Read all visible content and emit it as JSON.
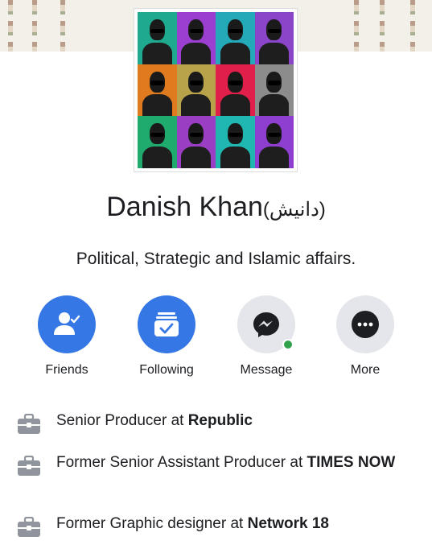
{
  "profile": {
    "name": "Danish Khan",
    "name_native": "(دانیش)",
    "bio": "Political, Strategic and Islamic affairs."
  },
  "actions": [
    {
      "label": "Friends",
      "icon": "friends-check-icon",
      "style": "blue"
    },
    {
      "label": "Following",
      "icon": "following-feed-icon",
      "style": "blue"
    },
    {
      "label": "Message",
      "icon": "messenger-icon",
      "style": "gray",
      "online": true
    },
    {
      "label": "More",
      "icon": "more-dots-icon",
      "style": "gray"
    }
  ],
  "work": [
    {
      "prefix": "Senior Producer at ",
      "org": "Republic",
      "icon": "briefcase-icon"
    },
    {
      "prefix": "Former Senior Assistant Producer at ",
      "org": "TIMES NOW",
      "icon": "briefcase-icon"
    },
    {
      "prefix": "Former Graphic designer at ",
      "org": "Network 18",
      "icon": "briefcase-icon"
    }
  ],
  "colors": {
    "accent": "#3578e5",
    "button_gray": "#e4e6eb",
    "online": "#31a24c",
    "tiles": [
      "#1fa98f",
      "#9b3fd0",
      "#23a9b8",
      "#8a45c8",
      "#e07a1f",
      "#b8a24a",
      "#e0204a",
      "#8c8c8c",
      "#1faa6e",
      "#9a3fc4",
      "#1fb7b0",
      "#8f3fcf"
    ]
  }
}
